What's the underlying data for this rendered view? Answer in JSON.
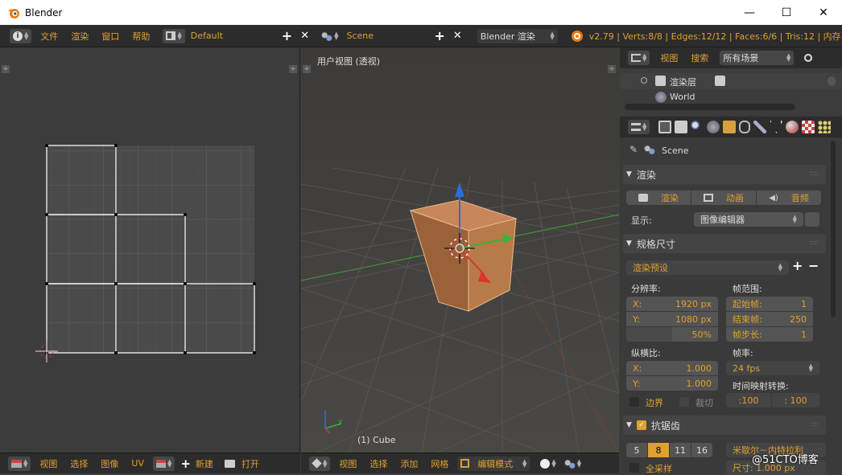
{
  "window": {
    "title": "Blender",
    "minimize": "—",
    "maximize": "☐",
    "close": "✕"
  },
  "topbar": {
    "menus": [
      "文件",
      "渲染",
      "窗口",
      "帮助"
    ],
    "layout": "Default",
    "scene": "Scene",
    "engine": "Blender 渲染",
    "stats": "v2.79 | Verts:8/8 | Edges:12/12 | Faces:6/6 | Tris:12 | 内存"
  },
  "viewport": {
    "label": "用户视图 (透视)",
    "object": "(1) Cube"
  },
  "outliner": {
    "view": "视图",
    "search": "搜索",
    "filter": "所有场景",
    "renderlayer": "渲染层",
    "world": "World"
  },
  "properties": {
    "context": "Scene",
    "render_section": "渲染",
    "tabs": [
      "渲染",
      "动画",
      "音频"
    ],
    "display_label": "显示:",
    "display_value": "图像编辑器",
    "dimensions_section": "规格尺寸",
    "preset": "渲染预设",
    "resolution_label": "分辨率:",
    "res_x_label": "X:",
    "res_x": "1920 px",
    "res_y_label": "Y:",
    "res_y": "1080 px",
    "res_pct": "50%",
    "frame_range_label": "帧范围:",
    "start_label": "起始帧:",
    "start": "1",
    "end_label": "结束帧:",
    "end": "250",
    "step_label": "帧步长:",
    "step": "1",
    "aspect_label": "纵横比:",
    "asp_x_label": "X:",
    "asp_x": "1.000",
    "asp_y_label": "Y:",
    "asp_y": "1.000",
    "fps_label": "帧率:",
    "fps": "24 fps",
    "timemap_label": "时间映射转换:",
    "tm_old": ":100",
    "tm_new": ": 100",
    "border": "边界",
    "crop": "裁切",
    "aa_section": "抗锯齿",
    "aa_samples": [
      "5",
      "8",
      "11",
      "16"
    ],
    "aa_filter": "米歇尔－内特拉利",
    "full_sample": "全采样",
    "size": "尺寸: 1.000 px"
  },
  "uv_bottom": {
    "menus": [
      "视图",
      "选择",
      "图像",
      "UV"
    ],
    "new": "新建",
    "open": "打开"
  },
  "view3d_bottom": {
    "menus": [
      "视图",
      "选择",
      "添加",
      "网格"
    ],
    "mode": "编辑模式"
  },
  "watermark": "@51CTO博客",
  "colors": {
    "accent": "#e0a030",
    "cube": "#b87a48",
    "x_axis": "#c83c3c",
    "y_axis": "#3cb040",
    "z_axis": "#2a6ed8"
  }
}
